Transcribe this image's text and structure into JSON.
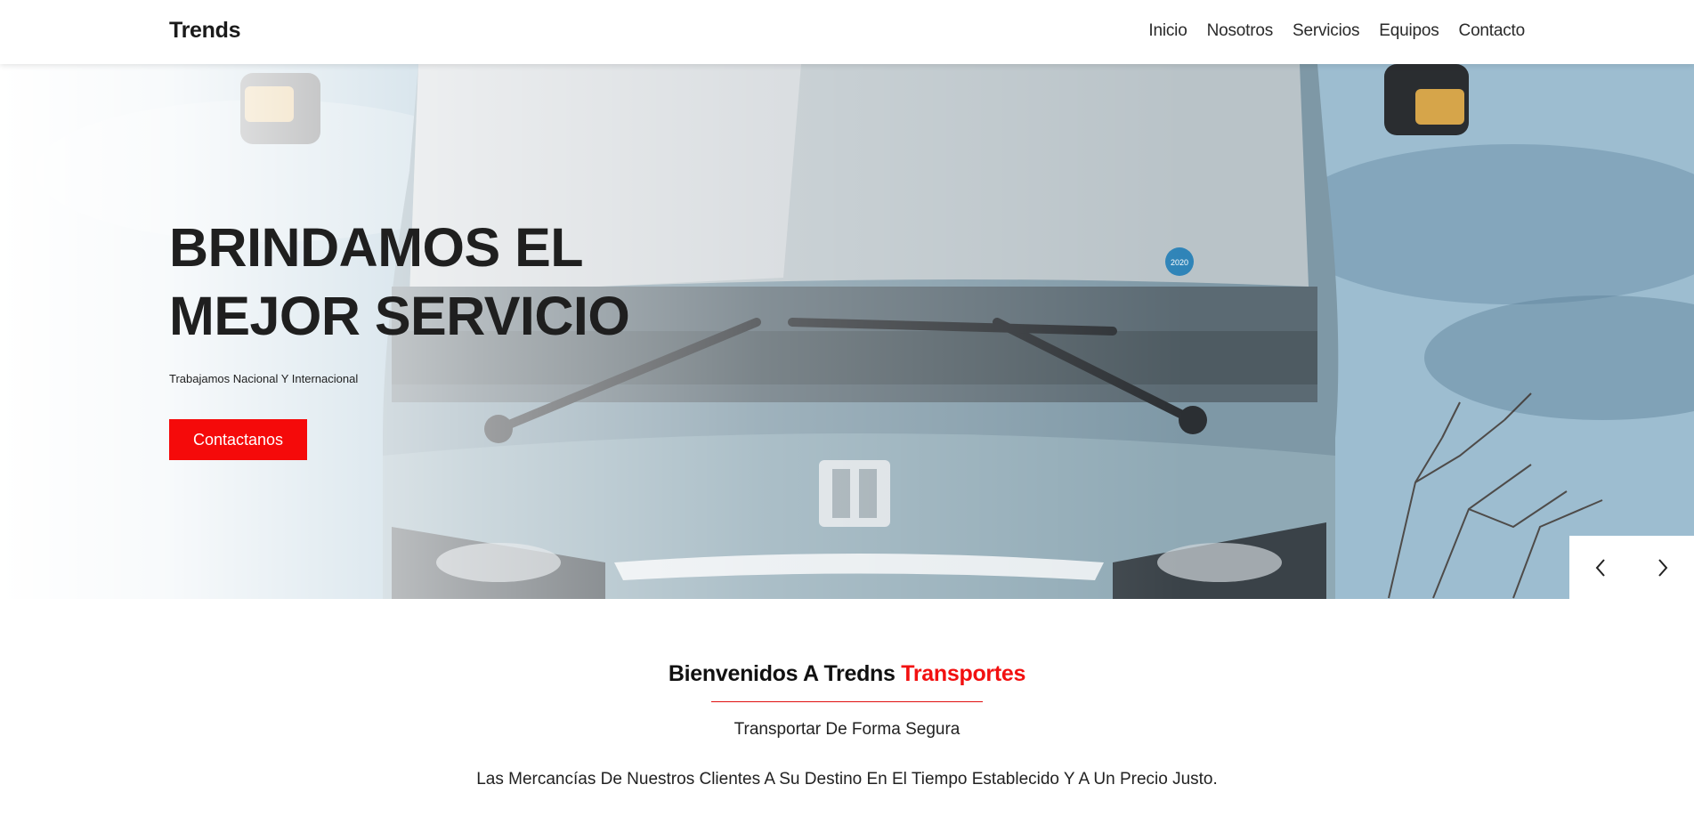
{
  "navbar": {
    "brand": "Trends",
    "links": [
      "Inicio",
      "Nosotros",
      "Servicios",
      "Equipos",
      "Contacto"
    ]
  },
  "hero": {
    "title_line1": "BRINDAMOS EL",
    "title_line2": "MEJOR SERVICIO",
    "subtitle": "Trabajamos Nacional Y Internacional",
    "cta_label": "Contactanos",
    "background_image": "bus-front-image",
    "sticker_text": "2020"
  },
  "carousel": {
    "prev_icon": "chevron-left-icon",
    "next_icon": "chevron-right-icon"
  },
  "welcome": {
    "title": "Bienvenidos A Tredns",
    "title_accent": "Transportes",
    "tagline": "Transportar De Forma Segura",
    "body": "Las Mercancías De Nuestros Clientes A Su Destino En El Tiempo Establecido Y A Un Precio Justo."
  },
  "colors": {
    "accent": "#f50a0a",
    "text": "#1a1a1a",
    "background": "#ffffff"
  }
}
